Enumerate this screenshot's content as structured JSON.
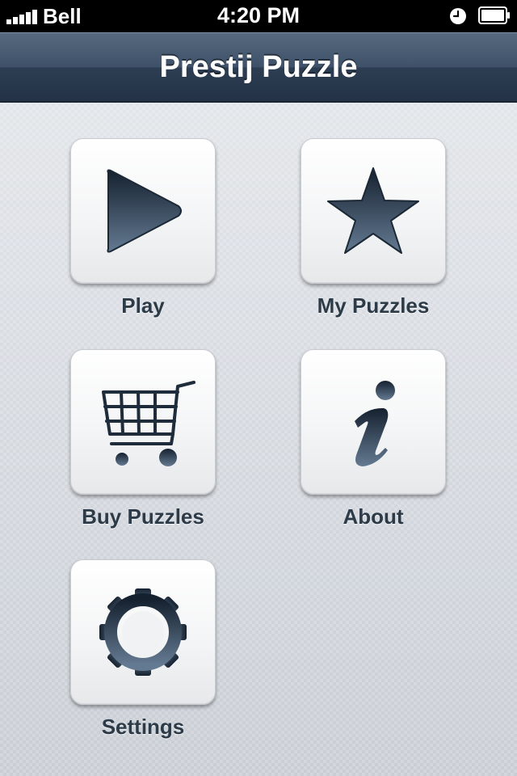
{
  "status_bar": {
    "carrier": "Bell",
    "time": "4:20 PM",
    "signal_bars": 5,
    "icons": [
      "signal-icon",
      "clock-icon",
      "battery-icon"
    ]
  },
  "nav": {
    "title": "Prestij Puzzle"
  },
  "menu": {
    "items": [
      {
        "label": "Play",
        "icon": "play-icon"
      },
      {
        "label": "My Puzzles",
        "icon": "star-icon"
      },
      {
        "label": "Buy Puzzles",
        "icon": "cart-icon"
      },
      {
        "label": "About",
        "icon": "info-icon"
      },
      {
        "label": "Settings",
        "icon": "gear-icon"
      }
    ]
  },
  "colors": {
    "nav_bar": "#3e5168",
    "icon_dark": "#1c2a3a",
    "icon_light": "#5d7188",
    "label_text": "#2d3a47"
  }
}
